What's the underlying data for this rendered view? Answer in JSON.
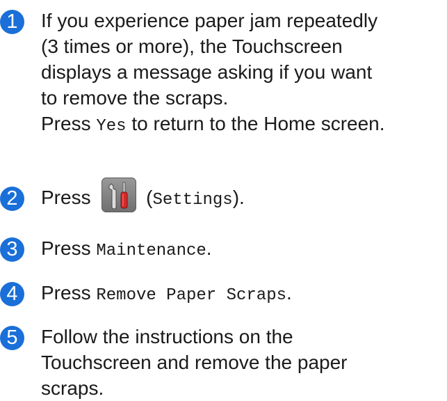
{
  "steps": [
    {
      "number": "1",
      "lines": [
        "If you experience paper jam repeatedly",
        "(3 times or more), the Touchscreen",
        "displays a message asking if you want",
        "to remove the scraps."
      ],
      "line5_prefix": "Press ",
      "line5_code": "Yes",
      "line5_suffix": " to return to the Home screen."
    },
    {
      "number": "2",
      "prefix": "Press ",
      "icon": "settings-icon",
      "paren_open": " (",
      "code": "Settings",
      "paren_close": ")."
    },
    {
      "number": "3",
      "prefix": "Press ",
      "code": "Maintenance",
      "suffix": "."
    },
    {
      "number": "4",
      "prefix": "Press ",
      "code": "Remove Paper Scraps",
      "suffix": "."
    },
    {
      "number": "5",
      "lines": [
        "Follow the instructions on the",
        "Touchscreen and remove the paper",
        "scraps."
      ]
    }
  ],
  "colors": {
    "badge": "#1a6fd8",
    "text": "#1a1a1a",
    "icon_background": "#888888"
  }
}
